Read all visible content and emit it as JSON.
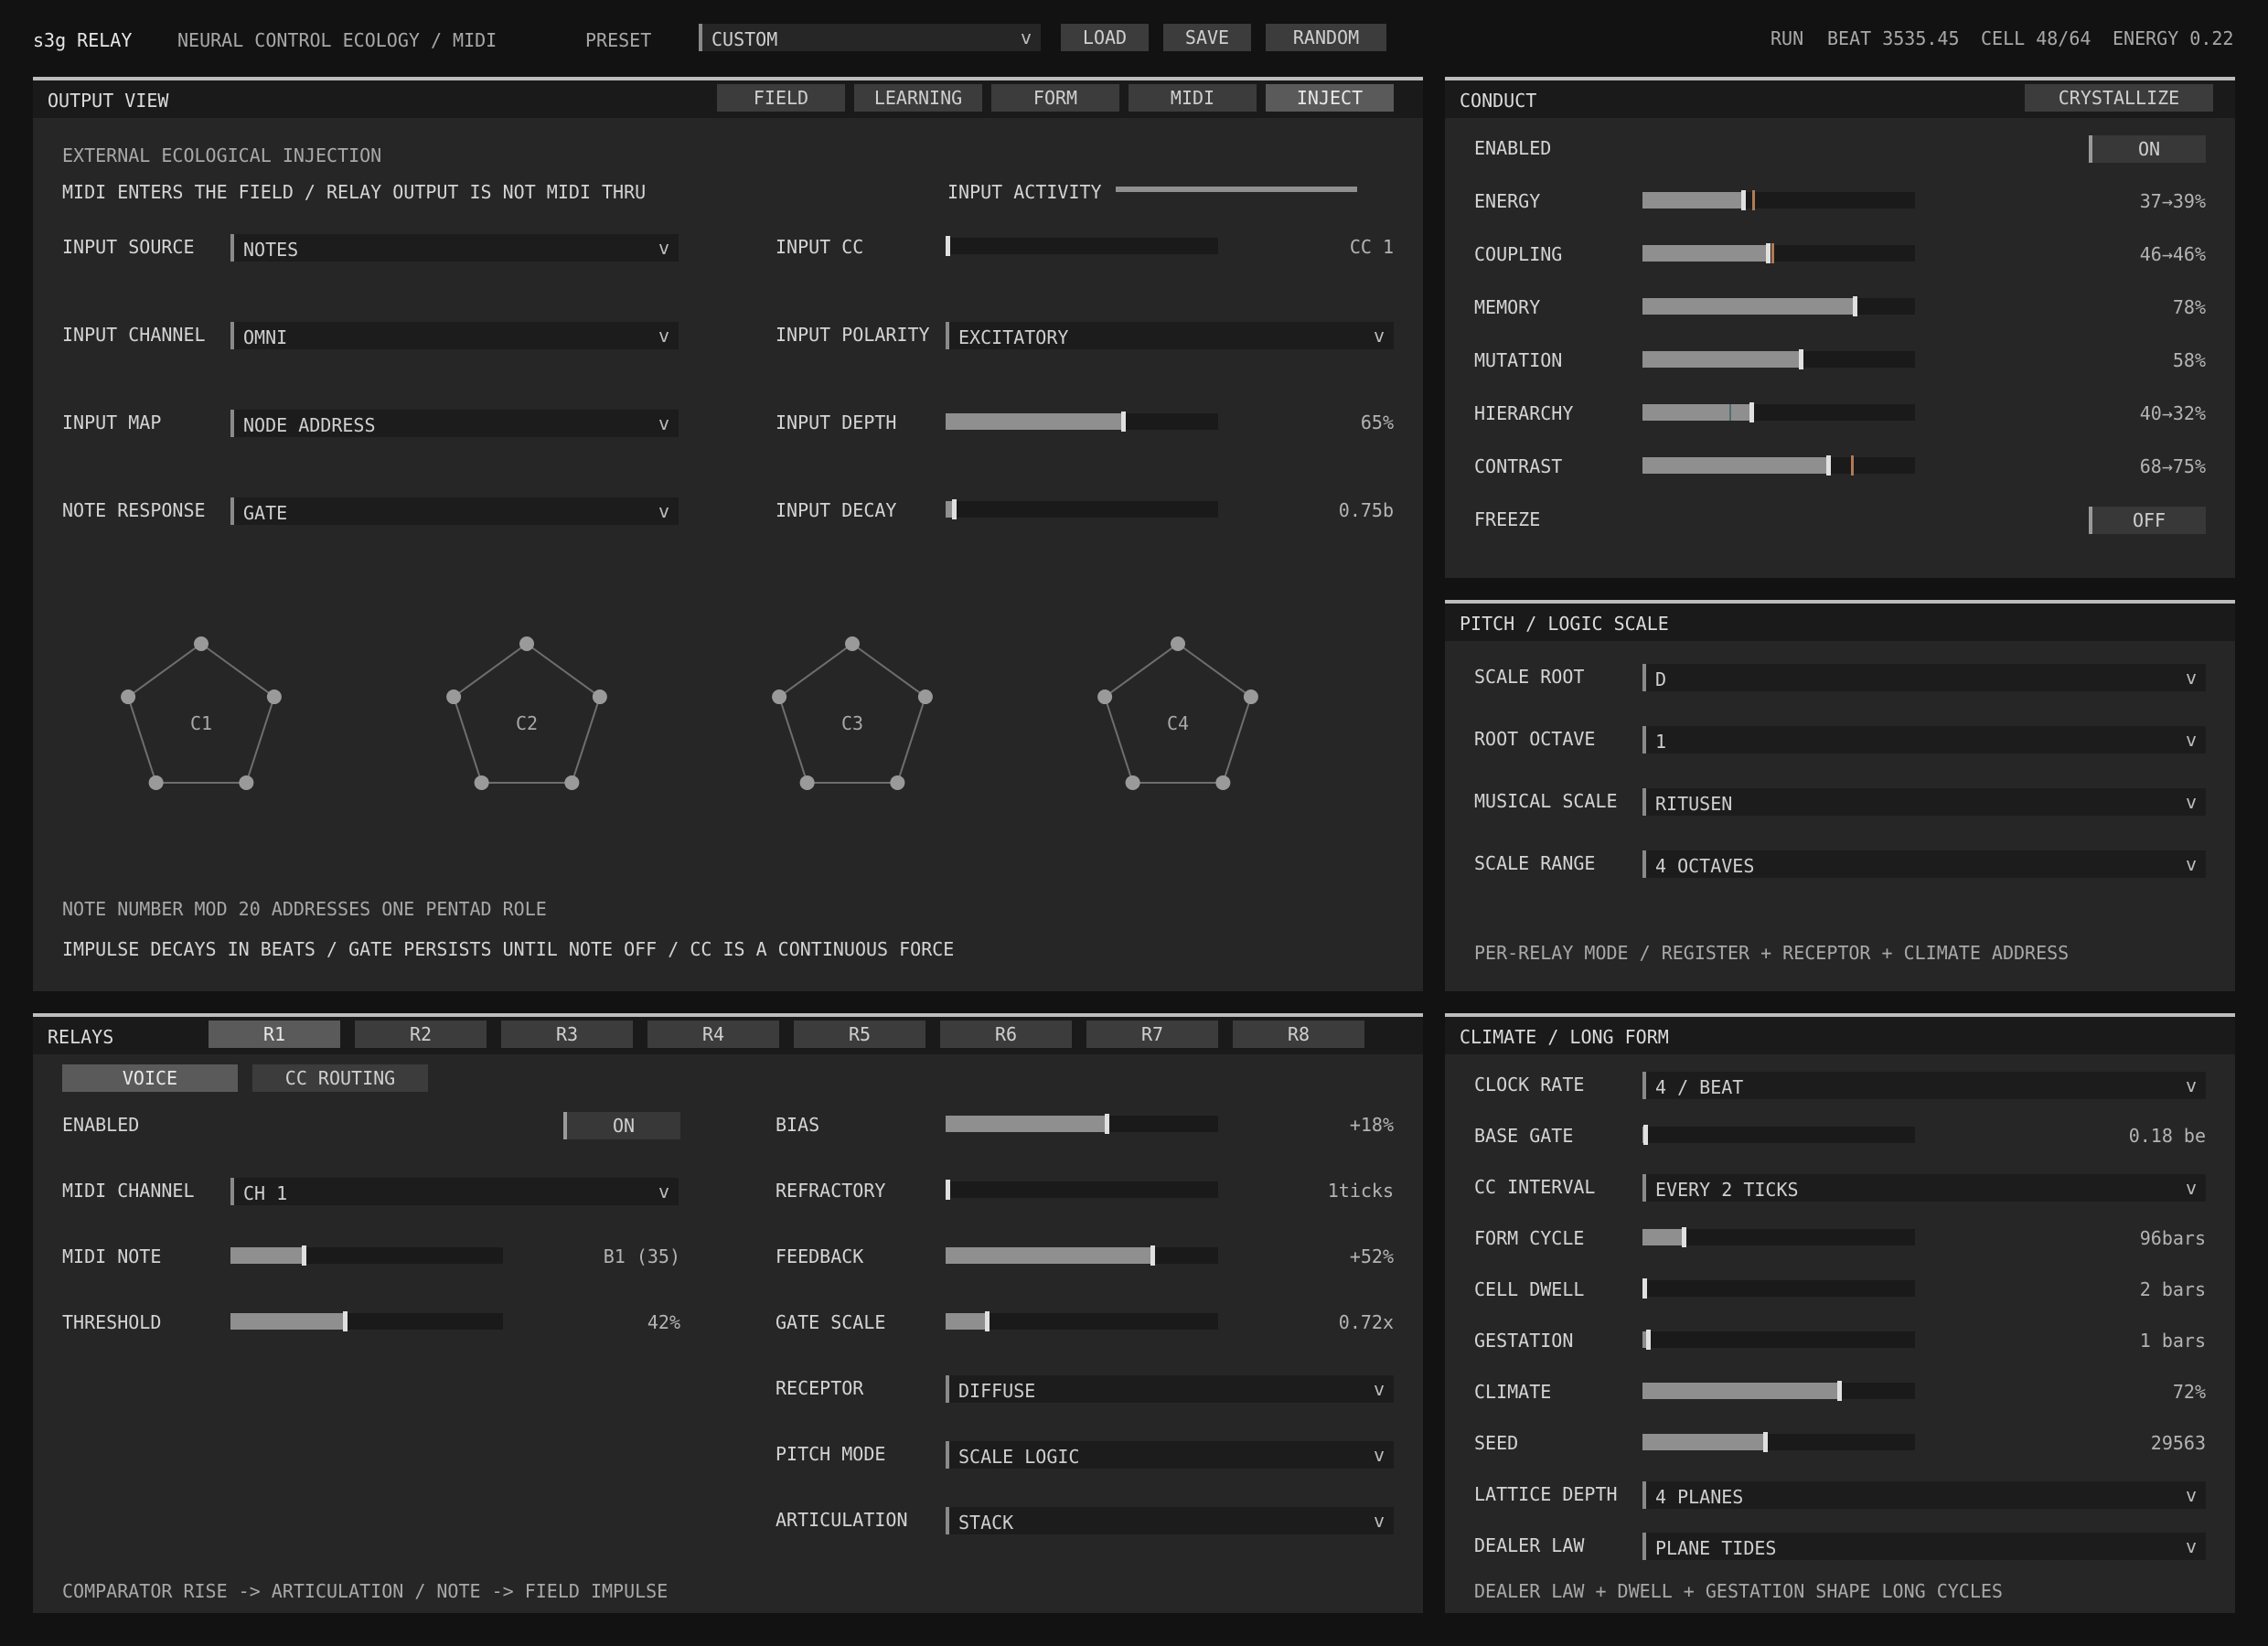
{
  "topbar": {
    "app": "s3g RELAY",
    "subtitle": "NEURAL CONTROL ECOLOGY / MIDI",
    "preset_label": "PRESET",
    "preset_value": "CUSTOM",
    "load": "LOAD",
    "save": "SAVE",
    "random": "RANDOM",
    "status": "RUN",
    "beat": "BEAT 3535.45",
    "cell": "CELL 48/64",
    "energy": "ENERGY 0.22"
  },
  "output": {
    "title": "OUTPUT VIEW",
    "tabs": [
      "FIELD",
      "LEARNING",
      "FORM",
      "MIDI",
      "INJECT"
    ],
    "active_tab": "INJECT",
    "heading": "EXTERNAL ECOLOGICAL INJECTION",
    "subheading": "MIDI ENTERS THE FIELD / RELAY OUTPUT IS NOT MIDI THRU",
    "input_activity_label": "INPUT ACTIVITY",
    "input_activity_level": 1.0,
    "input_source_label": "INPUT SOURCE",
    "input_source_value": "NOTES",
    "input_channel_label": "INPUT CHANNEL",
    "input_channel_value": "OMNI",
    "input_map_label": "INPUT MAP",
    "input_map_value": "NODE ADDRESS",
    "note_response_label": "NOTE RESPONSE",
    "note_response_value": "GATE",
    "input_cc_label": "INPUT CC",
    "input_cc_value": "CC 1",
    "input_cc_level": 0.0,
    "input_polarity_label": "INPUT POLARITY",
    "input_polarity_value": "EXCITATORY",
    "input_depth_label": "INPUT DEPTH",
    "input_depth_value": "65%",
    "input_depth_level": 0.65,
    "input_decay_label": "INPUT DECAY",
    "input_decay_value": "0.75b",
    "input_decay_level": 0.03,
    "pentads": [
      "C1",
      "C2",
      "C3",
      "C4"
    ],
    "note1": "NOTE NUMBER MOD 20 ADDRESSES ONE PENTAD ROLE",
    "note2": "IMPULSE DECAYS IN BEATS / GATE PERSISTS UNTIL NOTE OFF / CC IS A CONTINUOUS FORCE"
  },
  "conduct": {
    "title": "CONDUCT",
    "crystallize": "CRYSTALLIZE",
    "enabled_label": "ENABLED",
    "enabled_value": "ON",
    "freeze_label": "FREEZE",
    "freeze_value": "OFF",
    "rows": [
      {
        "label": "ENERGY",
        "value": "37→39%",
        "level": 0.37,
        "target": 0.39
      },
      {
        "label": "COUPLING",
        "value": "46→46%",
        "level": 0.46,
        "target": 0.46
      },
      {
        "label": "MEMORY",
        "value": "78%",
        "level": 0.78
      },
      {
        "label": "MUTATION",
        "value": "58%",
        "level": 0.58
      },
      {
        "label": "HIERARCHY",
        "value": "40→32%",
        "level": 0.4,
        "ghost": 0.32
      },
      {
        "label": "CONTRAST",
        "value": "68→75%",
        "level": 0.68,
        "target": 0.75
      }
    ]
  },
  "pitch": {
    "title": "PITCH / LOGIC SCALE",
    "scale_root_label": "SCALE ROOT",
    "scale_root_value": "D",
    "root_octave_label": "ROOT OCTAVE",
    "root_octave_value": "1",
    "musical_scale_label": "MUSICAL SCALE",
    "musical_scale_value": "RITUSEN",
    "scale_range_label": "SCALE RANGE",
    "scale_range_value": "4 OCTAVES",
    "footer": "PER-RELAY MODE / REGISTER + RECEPTOR + CLIMATE ADDRESS"
  },
  "relays": {
    "title": "RELAYS",
    "tabs": [
      "R1",
      "R2",
      "R3",
      "R4",
      "R5",
      "R6",
      "R7",
      "R8"
    ],
    "active_tab": "R1",
    "subtabs": [
      "VOICE",
      "CC ROUTING"
    ],
    "active_subtab": "VOICE",
    "enabled_label": "ENABLED",
    "enabled_value": "ON",
    "midi_channel_label": "MIDI CHANNEL",
    "midi_channel_value": "CH 1",
    "midi_note_label": "MIDI NOTE",
    "midi_note_value": "B1 (35)",
    "midi_note_level": 0.27,
    "threshold_label": "THRESHOLD",
    "threshold_value": "42%",
    "threshold_level": 0.42,
    "bias_label": "BIAS",
    "bias_value": "+18%",
    "bias_level": 0.59,
    "refractory_label": "REFRACTORY",
    "refractory_value": "1ticks",
    "refractory_level": 0.0,
    "feedback_label": "FEEDBACK",
    "feedback_value": "+52%",
    "feedback_level": 0.76,
    "gate_scale_label": "GATE SCALE",
    "gate_scale_value": "0.72x",
    "gate_scale_level": 0.15,
    "receptor_label": "RECEPTOR",
    "receptor_value": "DIFFUSE",
    "pitch_mode_label": "PITCH MODE",
    "pitch_mode_value": "SCALE LOGIC",
    "articulation_label": "ARTICULATION",
    "articulation_value": "STACK",
    "footer": "COMPARATOR RISE -> ARTICULATION / NOTE -> FIELD IMPULSE"
  },
  "climate": {
    "title": "CLIMATE / LONG FORM",
    "clock_rate_label": "CLOCK RATE",
    "clock_rate_value": "4 / BEAT",
    "base_gate_label": "BASE GATE",
    "base_gate_value": "0.18 be",
    "base_gate_level": 0.01,
    "cc_interval_label": "CC INTERVAL",
    "cc_interval_value": "EVERY 2 TICKS",
    "form_cycle_label": "FORM CYCLE",
    "form_cycle_value": "96bars",
    "form_cycle_level": 0.15,
    "cell_dwell_label": "CELL DWELL",
    "cell_dwell_value": "2 bars",
    "cell_dwell_level": 0.0,
    "gestation_label": "GESTATION",
    "gestation_value": "1 bars",
    "gestation_level": 0.02,
    "climate_label": "CLIMATE",
    "climate_value": "72%",
    "climate_level": 0.72,
    "seed_label": "SEED",
    "seed_value": "29563",
    "seed_level": 0.45,
    "lattice_depth_label": "LATTICE DEPTH",
    "lattice_depth_value": "4 PLANES",
    "dealer_law_label": "DEALER LAW",
    "dealer_law_value": "PLANE TIDES",
    "footer": "DEALER LAW + DWELL + GESTATION SHAPE LONG CYCLES"
  },
  "colors": {
    "background": "#121212",
    "panel": "#262626",
    "accent_target": "#b07a55",
    "ghost": "#4f6f6f"
  }
}
